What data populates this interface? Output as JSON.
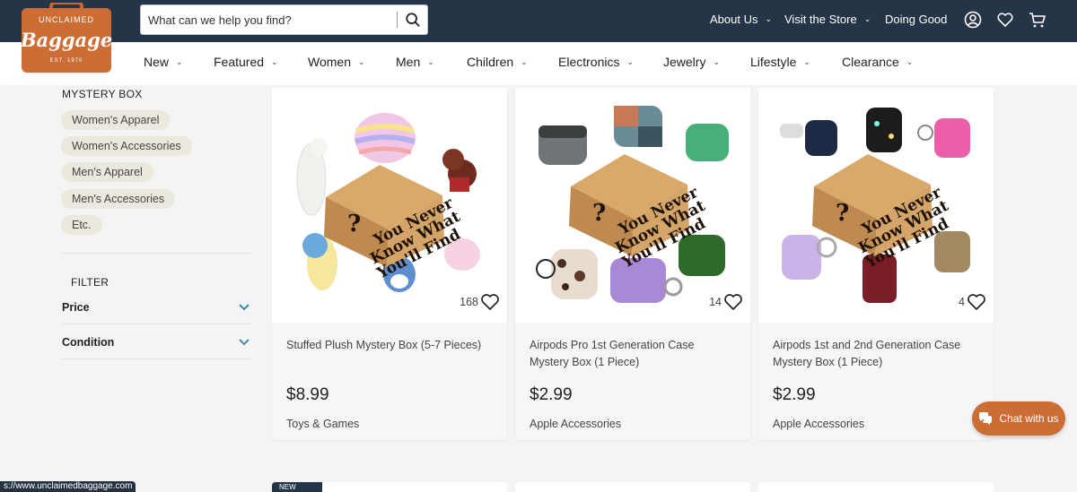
{
  "brand": {
    "logo_top": "UNCLAIMED",
    "logo_main": "Baggage",
    "logo_est": "EST. 1970"
  },
  "search": {
    "placeholder": "What can we help you find?"
  },
  "topnav": [
    {
      "label": "About Us"
    },
    {
      "label": "Visit the Store"
    },
    {
      "label": "Doing Good"
    }
  ],
  "icons": {
    "account": "user-circle-icon",
    "wishlist": "heart-icon",
    "cart": "cart-icon"
  },
  "categories": [
    {
      "label": "New"
    },
    {
      "label": "Featured"
    },
    {
      "label": "Women"
    },
    {
      "label": "Men"
    },
    {
      "label": "Children"
    },
    {
      "label": "Electronics"
    },
    {
      "label": "Jewelry"
    },
    {
      "label": "Lifestyle"
    },
    {
      "label": "Clearance"
    }
  ],
  "sidebar": {
    "title": "MYSTERY BOX",
    "chips": [
      {
        "label": "Women's Apparel"
      },
      {
        "label": "Women's Accessories"
      },
      {
        "label": "Men's Apparel"
      },
      {
        "label": "Men's Accessories"
      },
      {
        "label": "Etc."
      }
    ],
    "filter_title": "FILTER",
    "filters": [
      {
        "label": "Price"
      },
      {
        "label": "Condition"
      }
    ]
  },
  "products": [
    {
      "name": "Stuffed Plush Mystery Box (5-7 Pieces)",
      "price": "$8.99",
      "category": "Toys & Games",
      "favorites": "168"
    },
    {
      "name": "Airpods Pro 1st Generation Case Mystery Box (1 Piece)",
      "price": "$2.99",
      "category": "Apple Accessories",
      "favorites": "14"
    },
    {
      "name": "Airpods 1st and 2nd Generation Case Mystery Box (1 Piece)",
      "price": "$2.99",
      "category": "Apple Accessories",
      "favorites": "4"
    }
  ],
  "box_text": [
    "You Never",
    "Know What",
    "You'll Find"
  ],
  "badge": {
    "new": "NEW"
  },
  "chat": {
    "label": "Chat with us"
  },
  "status_url": "s://www.unclaimedbaggage.com",
  "colors": {
    "header": "#253447",
    "accent": "#cc6d35",
    "chevron": "#3a8fb7",
    "chip": "#ebe8de"
  }
}
